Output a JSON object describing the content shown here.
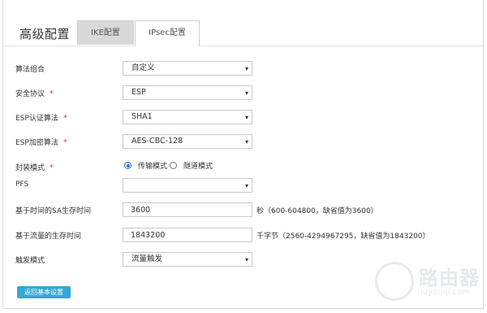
{
  "header": {
    "title": "高级配置",
    "tabs": [
      {
        "label": "IKE配置"
      },
      {
        "label": "IPsec配置"
      }
    ]
  },
  "form": {
    "algorithm_combo": {
      "label": "算法组合",
      "value": "自定义"
    },
    "security_protocol": {
      "label": "安全协议",
      "required": "*",
      "value": "ESP"
    },
    "esp_auth": {
      "label": "ESP认证算法",
      "required": "*",
      "value": "SHA1"
    },
    "esp_encrypt": {
      "label": "ESP加密算法",
      "required": "*",
      "value": "AES-CBC-128"
    },
    "encap_mode": {
      "label": "封装模式",
      "required": "*",
      "options": [
        "传输模式",
        "隧道模式"
      ],
      "selected": "传输模式"
    },
    "pfs": {
      "label": "PFS",
      "value": ""
    },
    "sa_lifetime_time": {
      "label": "基于时间的SA生存时间",
      "value": "3600",
      "hint": "秒（600-604800，缺省值为3600）"
    },
    "sa_lifetime_traffic": {
      "label": "基于流量的生存时间",
      "value": "1843200",
      "hint": "千字节（2560-4294967295，缺省值为1843200）"
    },
    "trigger_mode": {
      "label": "触发模式",
      "value": "流量触发"
    }
  },
  "footer": {
    "back_label": "返回基本设置"
  },
  "watermark": {
    "text": "路由器",
    "domain": "luyouqi.com"
  },
  "colors": {
    "accent": "#35a6d6",
    "required": "#e4393c",
    "tab_active_bg": "#d9d9d9"
  }
}
